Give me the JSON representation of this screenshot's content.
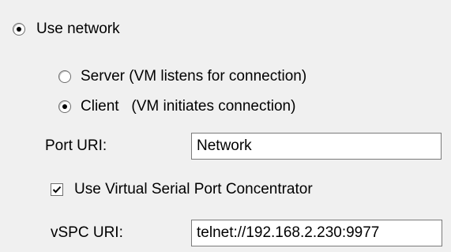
{
  "network": {
    "use_network_label": "Use network",
    "use_network_selected": true,
    "server_label": "Server (VM listens for connection)",
    "server_selected": false,
    "client_label": "Client   (VM initiates connection)",
    "client_selected": true,
    "port_uri_label": "Port URI:",
    "port_uri_value": "Network",
    "vspc_checkbox_label": "Use Virtual Serial Port Concentrator",
    "vspc_checked": true,
    "vspc_uri_label": "vSPC URI:",
    "vspc_uri_value": "telnet://192.168.2.230:9977"
  }
}
